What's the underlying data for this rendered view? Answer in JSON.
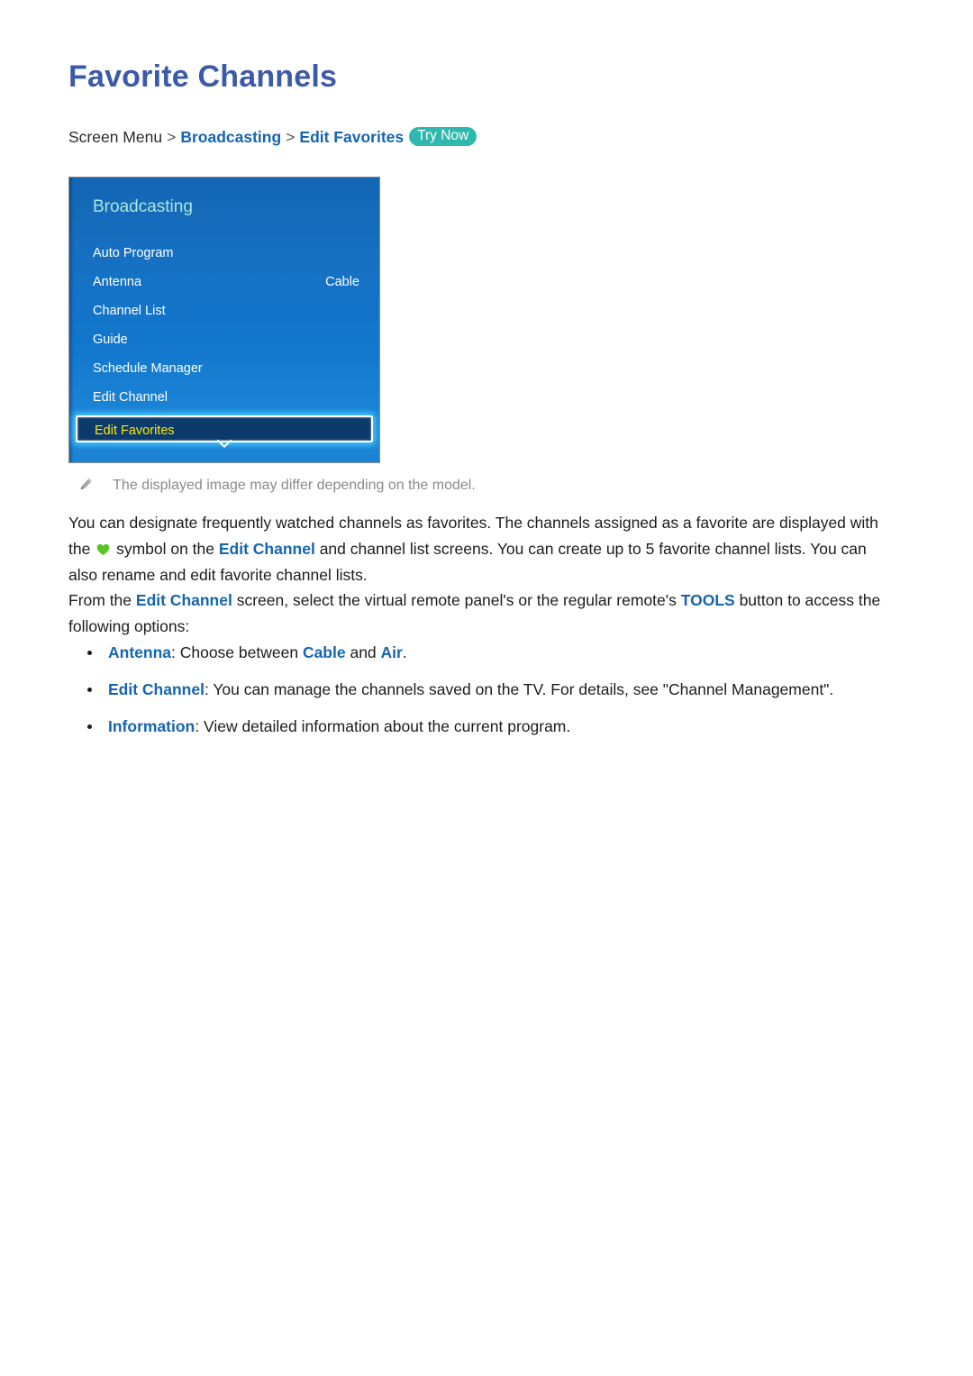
{
  "page": {
    "title": "Favorite Channels"
  },
  "breadcrumb": {
    "root": "Screen Menu",
    "separator": ">",
    "level2": "Broadcasting",
    "level3": "Edit Favorites",
    "badge": "Try Now"
  },
  "tv_menu": {
    "title": "Broadcasting",
    "items": [
      {
        "label": "Auto Program",
        "value": "",
        "selected": false
      },
      {
        "label": "Antenna",
        "value": "Cable",
        "selected": false
      },
      {
        "label": "Channel List",
        "value": "",
        "selected": false
      },
      {
        "label": "Guide",
        "value": "",
        "selected": false
      },
      {
        "label": "Schedule Manager",
        "value": "",
        "selected": false
      },
      {
        "label": "Edit Channel",
        "value": "",
        "selected": false
      },
      {
        "label": "Edit Favorites",
        "value": "",
        "selected": true
      }
    ],
    "scroll_hint": "chevron-down-icon"
  },
  "note": {
    "icon": "pencil-icon",
    "text": "The displayed image may differ depending on the model."
  },
  "paragraphs": {
    "p1_part1": "You can designate frequently watched channels as favorites. The channels assigned as a favorite are displayed with the ",
    "p1_heart_icon": "heart-icon",
    "p1_part2": " symbol on the ",
    "p1_link": "Edit Channel",
    "p1_part3": " and channel list screens. You can create up to 5 favorite channel lists. You can also rename and edit favorite channel lists.",
    "p2_part1": "From the ",
    "p2_link1": "Edit Channel",
    "p2_part2": " screen, select the virtual remote panel's or the regular remote's ",
    "p2_link2": "TOOLS",
    "p2_part3": " button to access the following options:"
  },
  "bullets": [
    {
      "term": "Antenna",
      "mid1": ": Choose between ",
      "link1": "Cable",
      "mid2": " and ",
      "link2": "Air",
      "tail": "."
    },
    {
      "term": "Edit Channel",
      "mid1": ": You can manage the channels saved on the TV. For details, see \"Channel Management\".",
      "link1": "",
      "mid2": "",
      "link2": "",
      "tail": ""
    },
    {
      "term": "Information",
      "mid1": ": View detailed information about the current program.",
      "link1": "",
      "mid2": "",
      "link2": "",
      "tail": ""
    }
  ],
  "colors": {
    "title_blue": "#3b5aa8",
    "link_blue": "#1565b0",
    "badge_teal": "#2fb8ae",
    "panel_blue": "#1277cc",
    "selected_navy": "#0c3b6b",
    "selected_yellow": "#ffe600",
    "glow_cyan": "#41c8ff",
    "heart_green": "#5cc420",
    "note_grey": "#8a8a8a"
  }
}
